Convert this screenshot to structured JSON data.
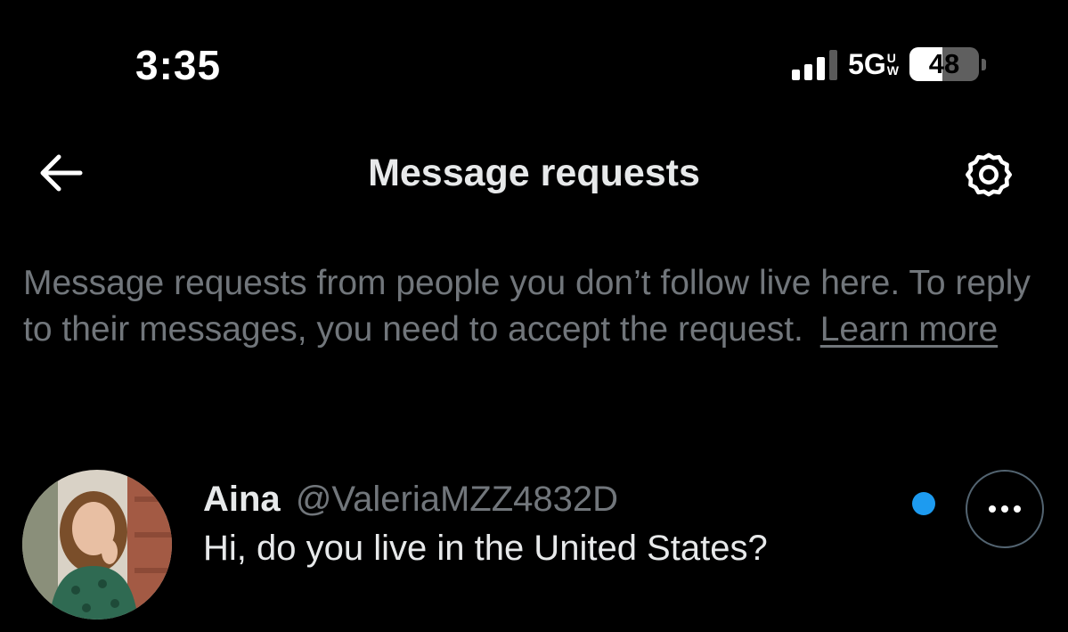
{
  "status_bar": {
    "time": "3:35",
    "network": "5G",
    "network_suffix_top": "U",
    "network_suffix_bottom": "W",
    "battery_level": "48",
    "battery_fraction": 0.48,
    "signal_bars_active": 3,
    "signal_bars_total": 4
  },
  "header": {
    "title": "Message requests",
    "back_icon": "arrow-left-icon",
    "settings_icon": "gear-icon"
  },
  "info": {
    "text": "Message requests from people you don’t follow live here. To reply to their messages, you need to accept the request.",
    "learn_more": "Learn more"
  },
  "requests": [
    {
      "name": "Aina",
      "handle": "@ValeriaMZZ4832D",
      "message": "Hi, do you live in the United States?",
      "unread": true,
      "more_icon": "more-horizontal-icon"
    }
  ],
  "colors": {
    "background": "#000000",
    "primary_text": "#e7e9ea",
    "secondary_text": "#71767b",
    "accent": "#1d9bf0",
    "border": "#536471"
  }
}
